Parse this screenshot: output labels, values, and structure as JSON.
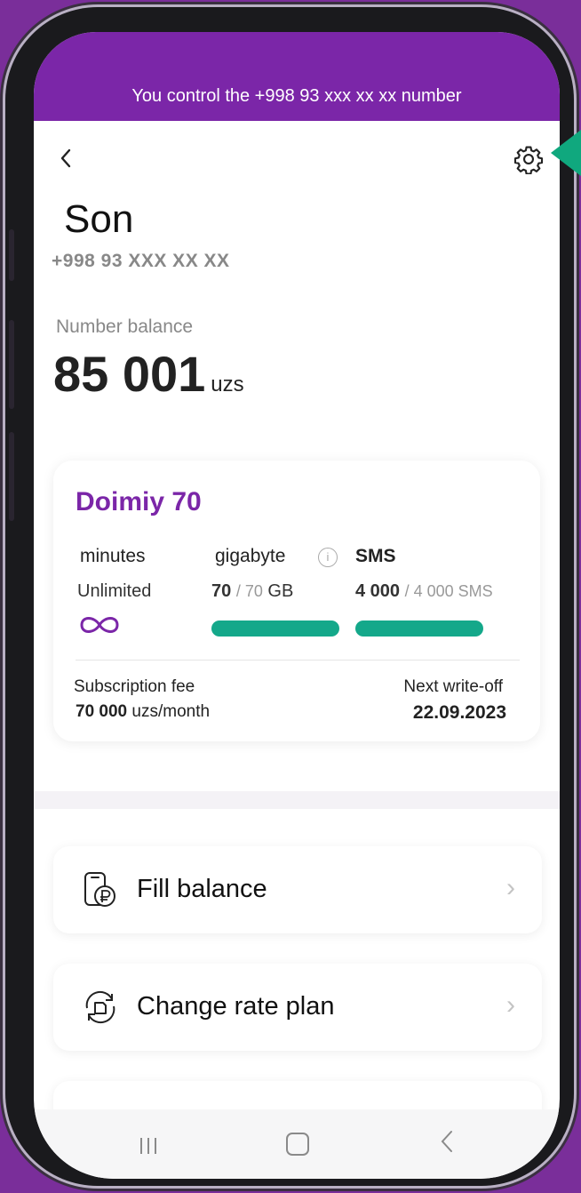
{
  "banner": {
    "text": "You control the +998 93 xxx xx xx number"
  },
  "header": {
    "back_label": "<"
  },
  "account": {
    "name": "Son",
    "phone": "+998 93 XXX XX XX"
  },
  "balance": {
    "label": "Number balance",
    "value": "85 001",
    "unit": "uzs"
  },
  "plan": {
    "name": "Doimiy 70",
    "minutes": {
      "title": "minutes",
      "value": "Unlimited"
    },
    "gigabyte": {
      "title": "gigabyte",
      "remaining": "70",
      "total": "/ 70",
      "unit": "GB",
      "fill": 1.0
    },
    "sms": {
      "title": "SMS",
      "remaining": "4 000",
      "total": "/ 4 000 SMS",
      "fill": 1.0
    },
    "fee_label": "Subscription fee",
    "fee_value": "70 000",
    "fee_unit": "uzs/month",
    "next_label": "Next write-off",
    "next_value": "22.09.2023"
  },
  "menu": [
    {
      "label": "Fill balance",
      "icon": "fill-balance-icon"
    },
    {
      "label": "Change rate plan",
      "icon": "change-plan-icon"
    }
  ],
  "colors": {
    "brand": "#7b26a8",
    "accent": "#14a88a",
    "pointer": "#10a87e"
  }
}
